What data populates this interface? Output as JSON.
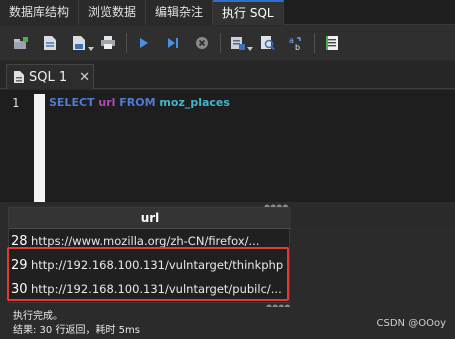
{
  "tabs": [
    {
      "label": "数据库结构"
    },
    {
      "label": "浏览数据"
    },
    {
      "label": "编辑杂注"
    },
    {
      "label": "执行 SQL",
      "active": true
    }
  ],
  "toolbar": {
    "icons": [
      "open-tab-icon",
      "open-sql-file-icon",
      "save-sql-file-icon",
      "print-icon",
      "execute-all-icon",
      "execute-current-line-icon",
      "stop-execution-icon",
      "save-results-icon",
      "find-icon",
      "find-replace-icon",
      "comment-icon"
    ]
  },
  "editor": {
    "tab_label": "SQL 1",
    "close_glyph": "✕",
    "line_number": "1",
    "sql": {
      "select_kw": "SELECT",
      "column": "url",
      "from_kw": "FROM",
      "table": "moz_places"
    }
  },
  "results": {
    "column_header": "url",
    "rows": [
      {
        "row_no": "28",
        "url": "https://www.mozilla.org/zh-CN/firefox/..."
      },
      {
        "row_no": "29",
        "url": "http://192.168.100.131/vulntarget/thinkphp"
      },
      {
        "row_no": "30",
        "url": "http://192.168.100.131/vulntarget/pubilc/..."
      }
    ]
  },
  "status": {
    "line1": "执行完成。",
    "line2": "结果: 30 行返回，耗时 5ms"
  },
  "watermark": "CSDN @OOoy",
  "colors": {
    "keyword": "#4e7bd3",
    "column": "#b04ab4",
    "table": "#3fb8c7",
    "highlight": "#e53935"
  }
}
